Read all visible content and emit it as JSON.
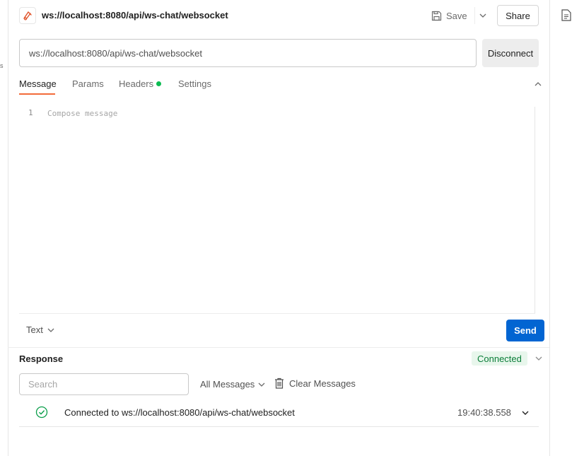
{
  "header": {
    "title": "ws://localhost:8080/api/ws-chat/websocket",
    "save_label": "Save",
    "share_label": "Share"
  },
  "url_bar": {
    "value": "ws://localhost:8080/api/ws-chat/websocket",
    "disconnect_label": "Disconnect"
  },
  "tabs": [
    {
      "label": "Message",
      "active": true
    },
    {
      "label": "Params",
      "active": false
    },
    {
      "label": "Headers",
      "active": false,
      "indicator_color": "#0cbb52"
    },
    {
      "label": "Settings",
      "active": false
    }
  ],
  "editor": {
    "line_number": "1",
    "placeholder": "Compose message",
    "format": "Text",
    "send_label": "Send"
  },
  "response": {
    "title": "Response",
    "status": "Connected",
    "search_placeholder": "Search",
    "filter": "All Messages",
    "clear_label": "Clear Messages",
    "messages": [
      {
        "icon": "check-circle-icon",
        "text": "Connected to ws://localhost:8080/api/ws-chat/websocket",
        "time": "19:40:38.558"
      }
    ]
  },
  "colors": {
    "accent_tab": "#f26b3a",
    "primary_button": "#0265d2",
    "connected_text": "#0a7d38",
    "connected_bg": "#e8f6ec"
  }
}
